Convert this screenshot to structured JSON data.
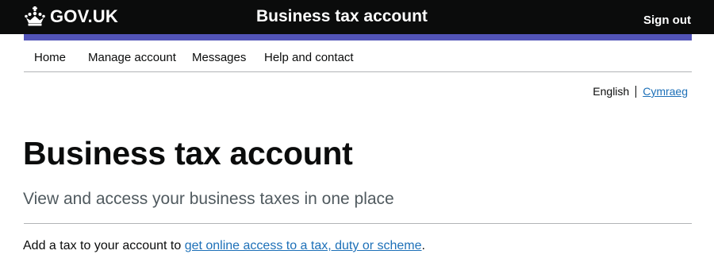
{
  "header": {
    "logo_text": "GOV.UK",
    "logo_icon": "crown-icon",
    "service_name": "Business tax account",
    "sign_out": "Sign out"
  },
  "nav": {
    "items": [
      {
        "label": "Home"
      },
      {
        "label": "Manage account"
      },
      {
        "label": "Messages"
      },
      {
        "label": "Help and contact"
      }
    ]
  },
  "language": {
    "current": "English",
    "alternate": "Cymraeg"
  },
  "main": {
    "title": "Business tax account",
    "lead": "View and access your business taxes in one place",
    "body_prefix": "Add a tax to your account to ",
    "body_link": "get online access to a tax, duty or scheme",
    "body_suffix": "."
  },
  "colors": {
    "header_bg": "#0b0c0c",
    "accent_bar": "#5254b8",
    "link": "#1d70b8",
    "secondary_text": "#505a5f"
  }
}
